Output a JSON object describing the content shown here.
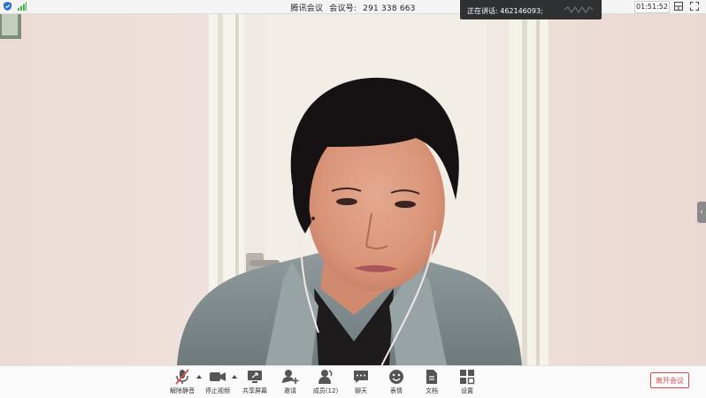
{
  "topbar": {
    "app_title": "腾讯会议",
    "meeting_id_label": "会议号:",
    "meeting_id": "291 338 663",
    "timer": "01:51:52",
    "icons": [
      "shield-icon",
      "signal-icon",
      "layout-icon",
      "fullscreen-icon"
    ]
  },
  "speaking": {
    "text": "正在讲话: 462146093;"
  },
  "video": {
    "participant": "462146093"
  },
  "toolbar": {
    "items": [
      {
        "label": "解除静音",
        "icon": "microphone-muted-icon"
      },
      {
        "label": "停止视频",
        "icon": "video-camera-icon"
      },
      {
        "label": "共享屏幕",
        "icon": "share-screen-icon"
      },
      {
        "label": "邀请",
        "icon": "invite-icon"
      },
      {
        "label": "成员(12)",
        "icon": "members-icon"
      },
      {
        "label": "聊天",
        "icon": "chat-icon"
      },
      {
        "label": "表情",
        "icon": "emoji-icon"
      },
      {
        "label": "文档",
        "icon": "document-icon"
      },
      {
        "label": "设置",
        "icon": "settings-icon"
      }
    ],
    "leave_label": "离开会议"
  },
  "colors": {
    "leave_red": "#e04848",
    "speaking_bg": "#2f3032",
    "shield_blue": "#2b6fd6",
    "signal_green": "#3bb54a"
  }
}
